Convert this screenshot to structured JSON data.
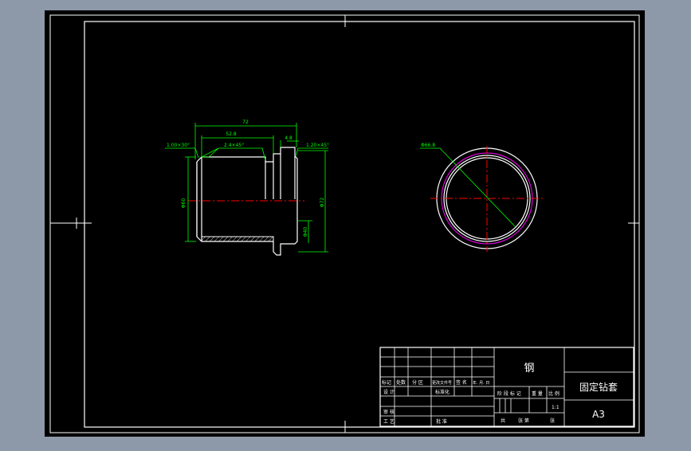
{
  "drawing": {
    "background": "#000000",
    "frame_color": "#ffffff",
    "outline_color": "#ffffff",
    "dimension_color": "#00ff00",
    "centerline_color": "#ff0000",
    "section_color": "#ff00ff",
    "hatch_color": "#d0d0d0"
  },
  "front_view": {
    "dims": {
      "overall_length": "72",
      "inner_length": "52.8",
      "step": "4.8",
      "chamfer_left": "1.00×30°",
      "chamfer_mid": "2.4×45°",
      "chamfer_right": "1.20×45°",
      "dia_left": "Φ60",
      "dia_right": "Φ72",
      "dia_bore": "Φ40"
    }
  },
  "side_view": {
    "dims": {
      "diameter": "Φ66.8"
    }
  },
  "title_block": {
    "material": "钢",
    "part_name": "固定钻套",
    "sheet_size": "A3",
    "scale": "1:1",
    "labels": {
      "mark": "标记",
      "count": "处数",
      "zone": "分 区",
      "change_doc": "更改文件号",
      "signature": "签 名",
      "date": "年. 月. 日",
      "design": "设 计",
      "standardize": "标准化",
      "review": "审 核",
      "process": "工 艺",
      "approve": "批 准",
      "stage_mark": "阶 段 标 记",
      "weight": "重 量",
      "ratio": "比 例",
      "total_sheets": "共",
      "sheet_no": "张  第",
      "sheet_unit": "张"
    }
  }
}
